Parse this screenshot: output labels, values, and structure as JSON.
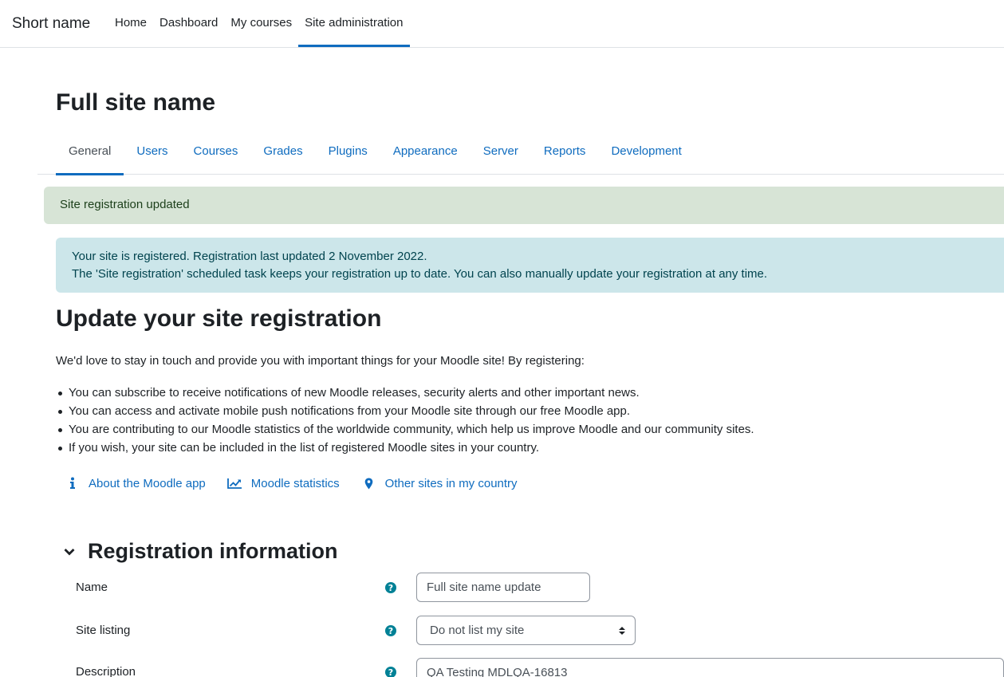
{
  "navbar": {
    "brand": "Short name",
    "items": [
      {
        "label": "Home"
      },
      {
        "label": "Dashboard"
      },
      {
        "label": "My courses"
      },
      {
        "label": "Site administration"
      }
    ],
    "active_item": "Site administration"
  },
  "page": {
    "title": "Full site name"
  },
  "tabs": {
    "items": [
      {
        "label": "General"
      },
      {
        "label": "Users"
      },
      {
        "label": "Courses"
      },
      {
        "label": "Grades"
      },
      {
        "label": "Plugins"
      },
      {
        "label": "Appearance"
      },
      {
        "label": "Server"
      },
      {
        "label": "Reports"
      },
      {
        "label": "Development"
      }
    ],
    "active_tab": "General"
  },
  "alerts": {
    "success": "Site registration updated",
    "info_line1": "Your site is registered. Registration last updated 2 November 2022.",
    "info_line2": "The 'Site registration' scheduled task keeps your registration up to date. You can also manually update your registration at any time."
  },
  "registration": {
    "heading": "Update your site registration",
    "intro": "We'd love to stay in touch and provide you with important things for your Moodle site! By registering:",
    "benefits": [
      "You can subscribe to receive notifications of new Moodle releases, security alerts and other important news.",
      "You can access and activate mobile push notifications from your Moodle site through our free Moodle app.",
      "You are contributing to our Moodle statistics of the worldwide community, which help us improve Moodle and our community sites.",
      "If you wish, your site can be included in the list of registered Moodle sites in your country."
    ],
    "links": [
      {
        "label": "About the Moodle app",
        "icon": "info-icon"
      },
      {
        "label": "Moodle statistics",
        "icon": "chart-line-icon"
      },
      {
        "label": "Other sites in my country",
        "icon": "map-marker-icon"
      }
    ]
  },
  "form": {
    "legend": "Registration information",
    "fields": {
      "name": {
        "label": "Name",
        "value": "Full site name update"
      },
      "site_listing": {
        "label": "Site listing",
        "value": "Do not list my site"
      },
      "description": {
        "label": "Description",
        "value": "QA Testing MDLQA-16813"
      }
    },
    "help_icon_glyph": "?"
  },
  "colors": {
    "link": "#0f6cbf",
    "success_bg": "#d7e4d6",
    "info_bg": "#cce6ea",
    "help_icon": "#008196"
  }
}
